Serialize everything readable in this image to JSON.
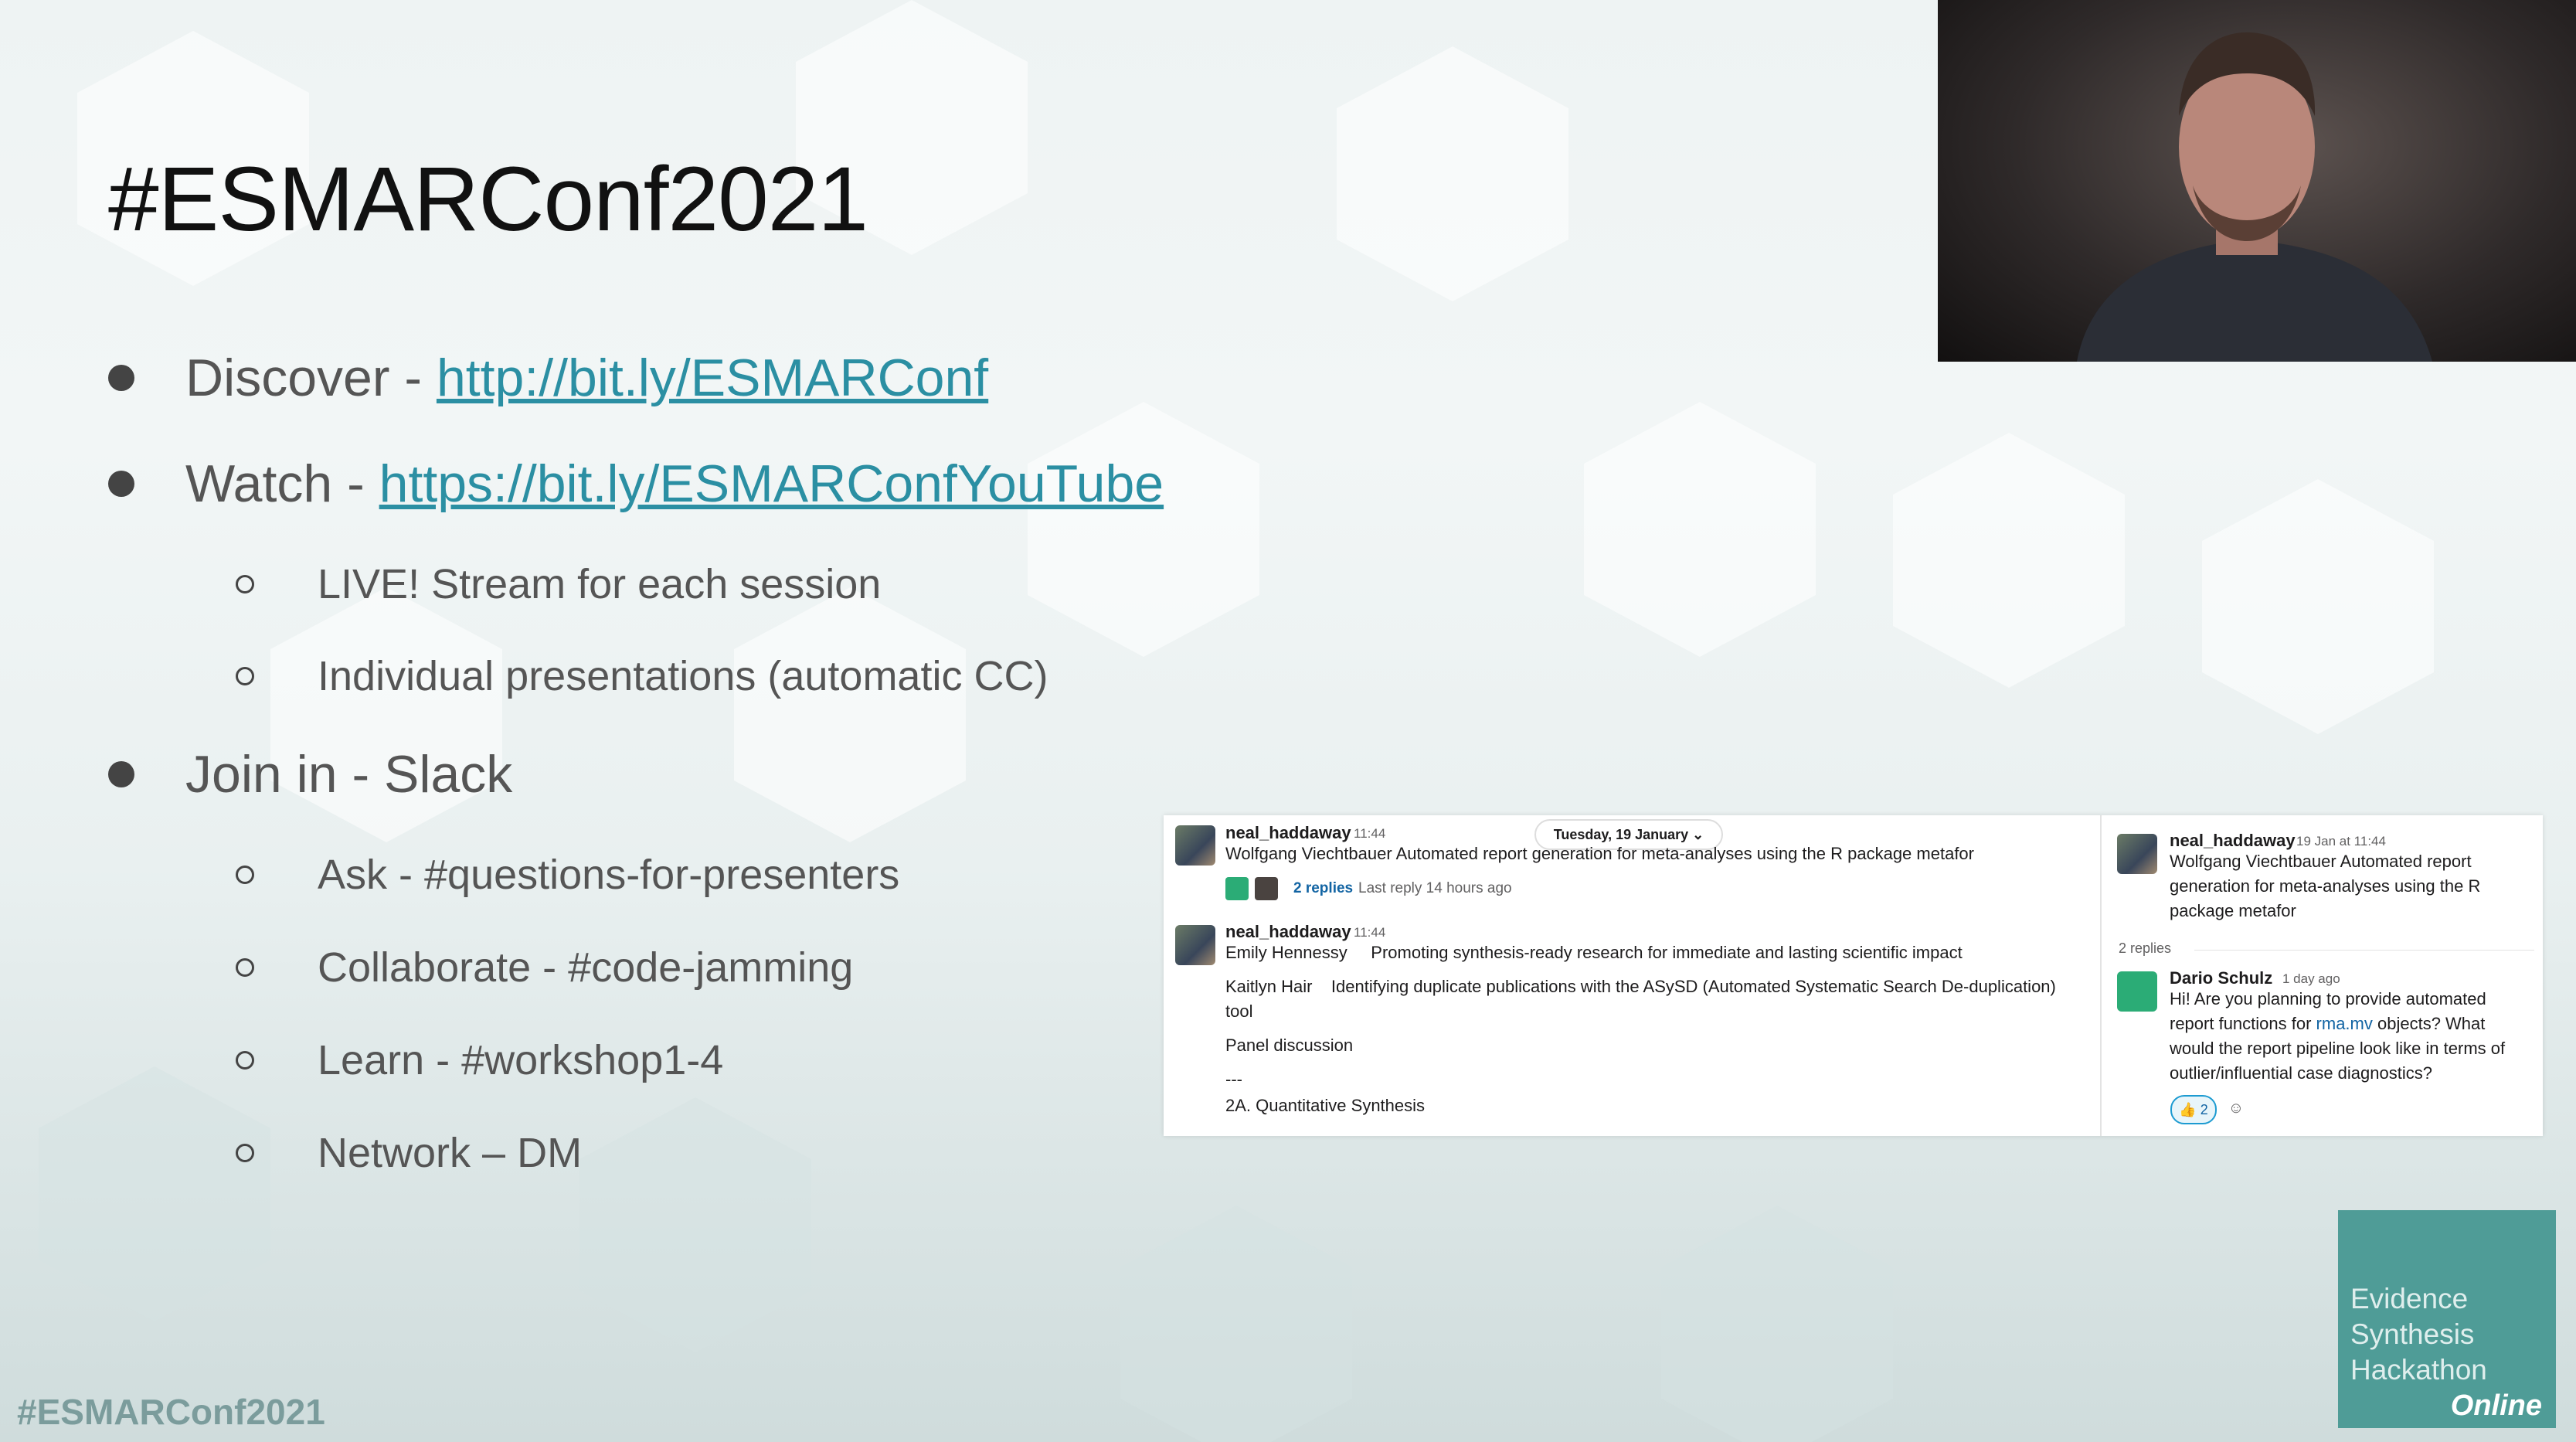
{
  "slide": {
    "title": "#ESMARConf2021",
    "bullets": [
      {
        "label": "Discover - ",
        "link": "http://bit.ly/ESMARConf"
      },
      {
        "label": "Watch - ",
        "link": "https://bit.ly/ESMARConfYouTube"
      },
      {
        "label": "LIVE! Stream for each session"
      },
      {
        "label": "Individual presentations (automatic CC)"
      },
      {
        "label": "Join in - Slack"
      },
      {
        "label": "Ask - #questions-for-presenters"
      },
      {
        "label": "Collaborate - #code-jamming"
      },
      {
        "label": "Learn - #workshop1-4"
      },
      {
        "label": "Network – DM"
      }
    ],
    "footer_hashtag": "#ESMARConf2021"
  },
  "logo": {
    "line1": "Evidence",
    "line2": "Synthesis",
    "line3": "Hackathon",
    "line4": "Online"
  },
  "slack": {
    "date_pill": "Tuesday, 19 January ⌄",
    "messages": [
      {
        "user": "neal_haddaway",
        "time": "11:44",
        "text": "Wolfgang Viechtbauer  Automated report generation for meta-analyses using the R package metafor",
        "replies": "2 replies",
        "last_reply": "Last reply 14 hours ago"
      },
      {
        "user": "neal_haddaway",
        "time": "11:44",
        "lines": [
          "Emily Hennessy     Promoting synthesis-ready research for immediate and lasting scientific impact",
          "Kaitlyn Hair    Identifying duplicate publications with the ASySD (Automated Systematic Search De-duplication)",
          "tool",
          "Panel discussion",
          "---",
          "2A. Quantitative Synthesis"
        ]
      }
    ],
    "thread": {
      "parent_user": "neal_haddaway",
      "parent_time": "19 Jan at 11:44",
      "parent_lines": [
        "Wolfgang Viechtbauer  Automated report",
        "generation for meta-analyses using the R",
        "package metafor"
      ],
      "replies_count": "2 replies",
      "reply_user": "Dario Schulz",
      "reply_time": "1 day ago",
      "reply_lines": [
        "Hi! Are you planning to provide automated",
        "report functions for ",
        "rma.mv",
        " objects? What",
        "would the report pipeline look like in terms of",
        "outlier/influential case diagnostics?"
      ],
      "reaction": "👍 2",
      "add_reaction": "☺"
    }
  },
  "colors": {
    "link": "#2b8fa3",
    "slack_link": "#1264a3",
    "logo_bg": "#4f9c97"
  }
}
